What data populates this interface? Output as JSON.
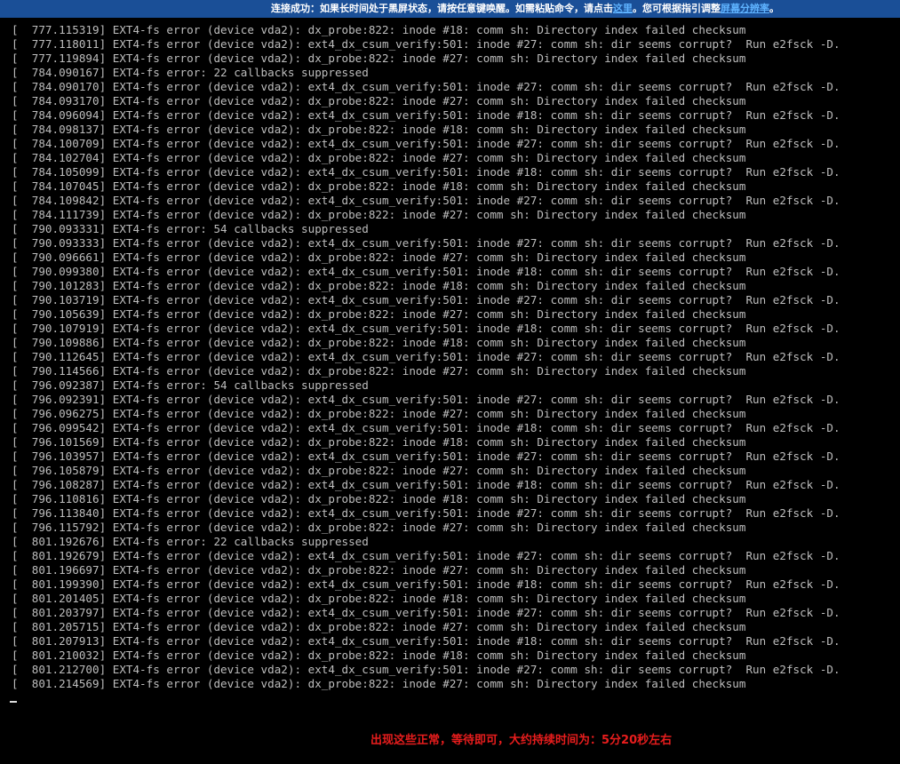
{
  "banner": {
    "text_before_link": "连接成功：如果长时间处于黑屏状态，请按任意键唤醒。如需粘贴命令，请点击",
    "link_here": "这里",
    "text_middle": "。您可根据指引调整",
    "link_scale": "屏幕分辨率",
    "text_after": "。"
  },
  "console": {
    "cursor": "_",
    "lines": [
      "[  777.115319] EXT4-fs error (device vda2): dx_probe:822: inode #18: comm sh: Directory index failed checksum",
      "[  777.118011] EXT4-fs error (device vda2): ext4_dx_csum_verify:501: inode #27: comm sh: dir seems corrupt?  Run e2fsck -D.",
      "[  777.119894] EXT4-fs error (device vda2): dx_probe:822: inode #27: comm sh: Directory index failed checksum",
      "[  784.090167] EXT4-fs error: 22 callbacks suppressed",
      "[  784.090170] EXT4-fs error (device vda2): ext4_dx_csum_verify:501: inode #27: comm sh: dir seems corrupt?  Run e2fsck -D.",
      "[  784.093170] EXT4-fs error (device vda2): dx_probe:822: inode #27: comm sh: Directory index failed checksum",
      "[  784.096094] EXT4-fs error (device vda2): ext4_dx_csum_verify:501: inode #18: comm sh: dir seems corrupt?  Run e2fsck -D.",
      "[  784.098137] EXT4-fs error (device vda2): dx_probe:822: inode #18: comm sh: Directory index failed checksum",
      "[  784.100709] EXT4-fs error (device vda2): ext4_dx_csum_verify:501: inode #27: comm sh: dir seems corrupt?  Run e2fsck -D.",
      "[  784.102704] EXT4-fs error (device vda2): dx_probe:822: inode #27: comm sh: Directory index failed checksum",
      "[  784.105099] EXT4-fs error (device vda2): ext4_dx_csum_verify:501: inode #18: comm sh: dir seems corrupt?  Run e2fsck -D.",
      "[  784.107045] EXT4-fs error (device vda2): dx_probe:822: inode #18: comm sh: Directory index failed checksum",
      "[  784.109842] EXT4-fs error (device vda2): ext4_dx_csum_verify:501: inode #27: comm sh: dir seems corrupt?  Run e2fsck -D.",
      "[  784.111739] EXT4-fs error (device vda2): dx_probe:822: inode #27: comm sh: Directory index failed checksum",
      "[  790.093331] EXT4-fs error: 54 callbacks suppressed",
      "[  790.093333] EXT4-fs error (device vda2): ext4_dx_csum_verify:501: inode #27: comm sh: dir seems corrupt?  Run e2fsck -D.",
      "[  790.096661] EXT4-fs error (device vda2): dx_probe:822: inode #27: comm sh: Directory index failed checksum",
      "[  790.099380] EXT4-fs error (device vda2): ext4_dx_csum_verify:501: inode #18: comm sh: dir seems corrupt?  Run e2fsck -D.",
      "[  790.101283] EXT4-fs error (device vda2): dx_probe:822: inode #18: comm sh: Directory index failed checksum",
      "[  790.103719] EXT4-fs error (device vda2): ext4_dx_csum_verify:501: inode #27: comm sh: dir seems corrupt?  Run e2fsck -D.",
      "[  790.105639] EXT4-fs error (device vda2): dx_probe:822: inode #27: comm sh: Directory index failed checksum",
      "[  790.107919] EXT4-fs error (device vda2): ext4_dx_csum_verify:501: inode #18: comm sh: dir seems corrupt?  Run e2fsck -D.",
      "[  790.109886] EXT4-fs error (device vda2): dx_probe:822: inode #18: comm sh: Directory index failed checksum",
      "[  790.112645] EXT4-fs error (device vda2): ext4_dx_csum_verify:501: inode #27: comm sh: dir seems corrupt?  Run e2fsck -D.",
      "[  790.114566] EXT4-fs error (device vda2): dx_probe:822: inode #27: comm sh: Directory index failed checksum",
      "[  796.092387] EXT4-fs error: 54 callbacks suppressed",
      "[  796.092391] EXT4-fs error (device vda2): ext4_dx_csum_verify:501: inode #27: comm sh: dir seems corrupt?  Run e2fsck -D.",
      "[  796.096275] EXT4-fs error (device vda2): dx_probe:822: inode #27: comm sh: Directory index failed checksum",
      "[  796.099542] EXT4-fs error (device vda2): ext4_dx_csum_verify:501: inode #18: comm sh: dir seems corrupt?  Run e2fsck -D.",
      "[  796.101569] EXT4-fs error (device vda2): dx_probe:822: inode #18: comm sh: Directory index failed checksum",
      "[  796.103957] EXT4-fs error (device vda2): ext4_dx_csum_verify:501: inode #27: comm sh: dir seems corrupt?  Run e2fsck -D.",
      "[  796.105879] EXT4-fs error (device vda2): dx_probe:822: inode #27: comm sh: Directory index failed checksum",
      "[  796.108287] EXT4-fs error (device vda2): ext4_dx_csum_verify:501: inode #18: comm sh: dir seems corrupt?  Run e2fsck -D.",
      "[  796.110816] EXT4-fs error (device vda2): dx_probe:822: inode #18: comm sh: Directory index failed checksum",
      "[  796.113840] EXT4-fs error (device vda2): ext4_dx_csum_verify:501: inode #27: comm sh: dir seems corrupt?  Run e2fsck -D.",
      "[  796.115792] EXT4-fs error (device vda2): dx_probe:822: inode #27: comm sh: Directory index failed checksum",
      "[  801.192676] EXT4-fs error: 22 callbacks suppressed",
      "[  801.192679] EXT4-fs error (device vda2): ext4_dx_csum_verify:501: inode #27: comm sh: dir seems corrupt?  Run e2fsck -D.",
      "[  801.196697] EXT4-fs error (device vda2): dx_probe:822: inode #27: comm sh: Directory index failed checksum",
      "[  801.199390] EXT4-fs error (device vda2): ext4_dx_csum_verify:501: inode #18: comm sh: dir seems corrupt?  Run e2fsck -D.",
      "[  801.201405] EXT4-fs error (device vda2): dx_probe:822: inode #18: comm sh: Directory index failed checksum",
      "[  801.203797] EXT4-fs error (device vda2): ext4_dx_csum_verify:501: inode #27: comm sh: dir seems corrupt?  Run e2fsck -D.",
      "[  801.205715] EXT4-fs error (device vda2): dx_probe:822: inode #27: comm sh: Directory index failed checksum",
      "[  801.207913] EXT4-fs error (device vda2): ext4_dx_csum_verify:501: inode #18: comm sh: dir seems corrupt?  Run e2fsck -D.",
      "[  801.210032] EXT4-fs error (device vda2): dx_probe:822: inode #18: comm sh: Directory index failed checksum",
      "[  801.212700] EXT4-fs error (device vda2): ext4_dx_csum_verify:501: inode #27: comm sh: dir seems corrupt?  Run e2fsck -D.",
      "[  801.214569] EXT4-fs error (device vda2): dx_probe:822: inode #27: comm sh: Directory index failed checksum"
    ]
  },
  "annotation": {
    "text": "出现这些正常，等待即可，大约持续时间为：5分20秒左右"
  },
  "colors": {
    "banner_bg": "#1a4f97",
    "banner_link": "#5fb3ff",
    "console_bg": "#000000",
    "console_text": "#bdbdbd",
    "annotation": "#e81d1d"
  }
}
